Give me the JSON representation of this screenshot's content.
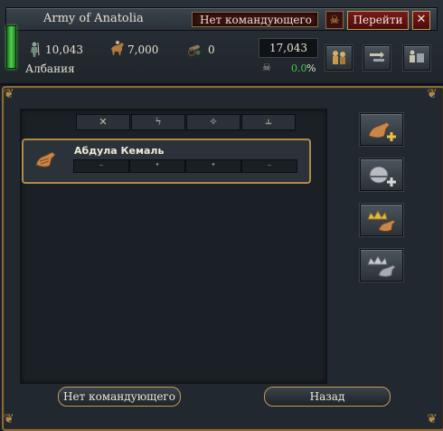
{
  "header": {
    "army_name": "Army of Anatolia",
    "commander_field": "Нет командующего",
    "go_button": "Перейти",
    "close_button": "✕",
    "infantry": "10,043",
    "cavalry": "7,000",
    "artillery": "0",
    "total": "17,043",
    "location": "Албания",
    "morale_value": "0.0",
    "morale_unit": "%"
  },
  "tabs": [
    {
      "icon": "crossed-swords-icon",
      "glyph": "✕"
    },
    {
      "icon": "lightning-icon",
      "glyph": "ϟ"
    },
    {
      "icon": "star-arrow-icon",
      "glyph": "✧"
    },
    {
      "icon": "cannon-icon",
      "glyph": "⥿"
    }
  ],
  "leader": {
    "name": "Абдула Кемаль",
    "skills": [
      "–",
      "•",
      "•",
      "–"
    ]
  },
  "buttons": {
    "no_commander": "Нет командующего",
    "back": "Назад"
  },
  "colors": {
    "gold_border": "#b08a48",
    "red_button": "#7a1a1a",
    "morale_green": "#3fd04a",
    "panel_bg": "#222830"
  }
}
